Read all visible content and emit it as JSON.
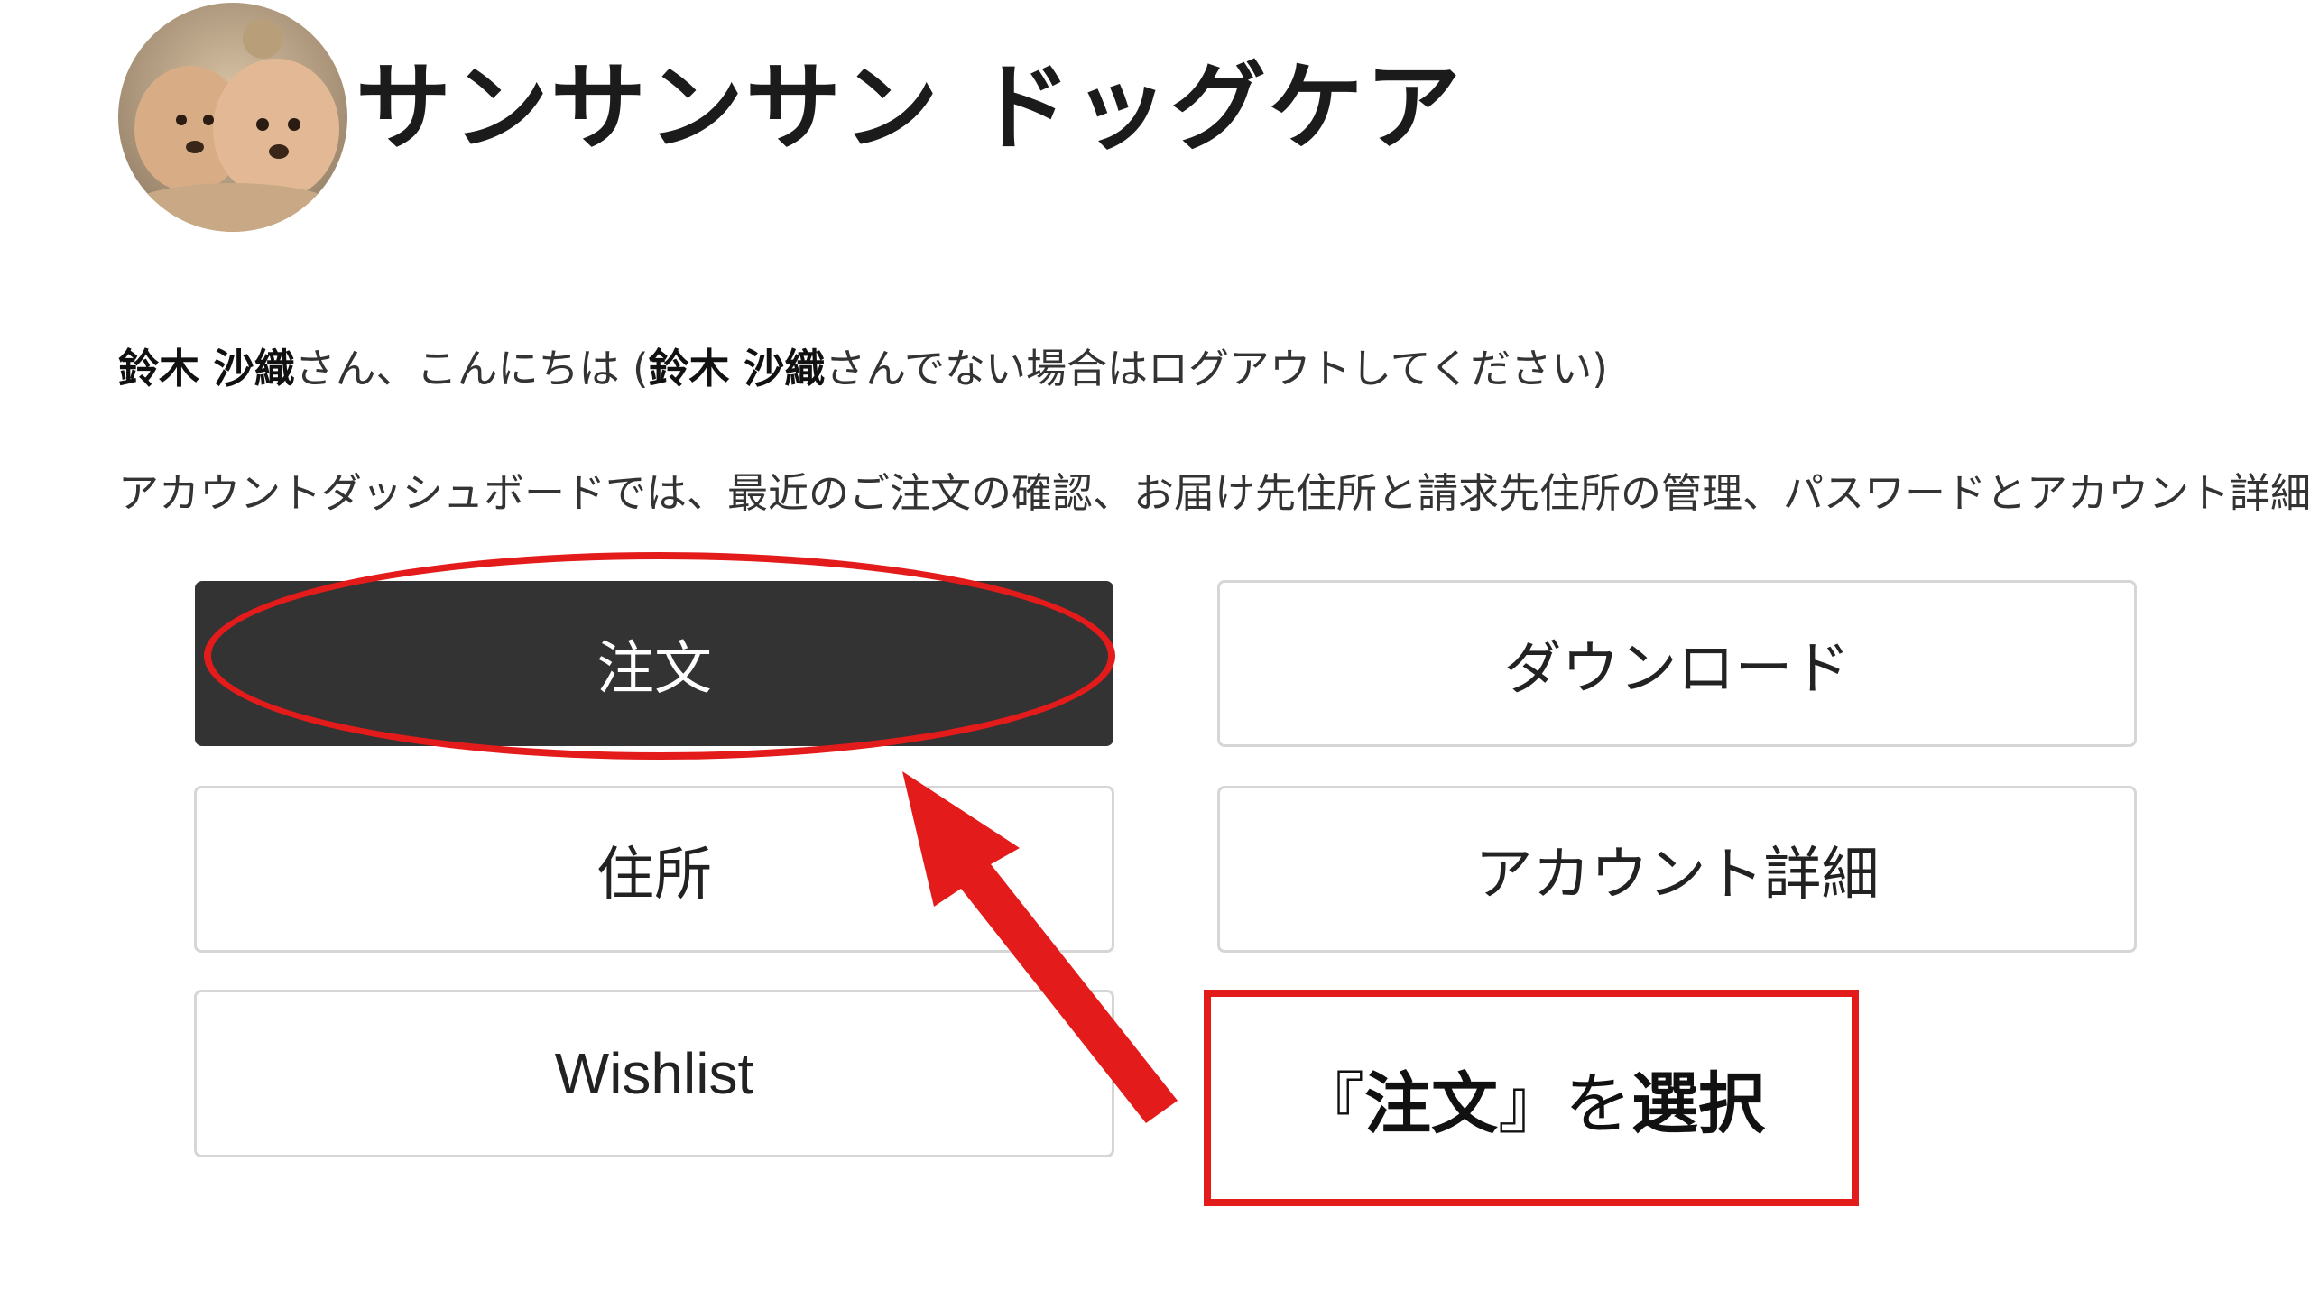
{
  "header": {
    "site_title": "サンサンサン ドッグケア",
    "avatar_icon": "dog-photo-avatar"
  },
  "greeting": {
    "user_name": "鈴木 沙織",
    "part1": "さん、こんにちは (",
    "user_name_2": "鈴木 沙織",
    "part2": "さんでない場合はログアウトしてください)"
  },
  "dashboard_text": "アカウントダッシュボードでは、最近のご注文の確認、お届け先住所と請求先住所の管理、パスワードとアカウント詳細の編集ができます。",
  "nav": {
    "orders": "注文",
    "downloads": "ダウンロード",
    "addresses": "住所",
    "account_details": "アカウント詳細",
    "wishlist": "Wishlist"
  },
  "annotation": {
    "callout_prefix": "『",
    "callout_target": "注文",
    "callout_suffix": "』",
    "callout_particle": "を",
    "callout_action": "選択",
    "highlight_color": "#e31b1b"
  },
  "colors": {
    "active_button_bg": "#333333",
    "button_border": "#d6d6d6"
  }
}
